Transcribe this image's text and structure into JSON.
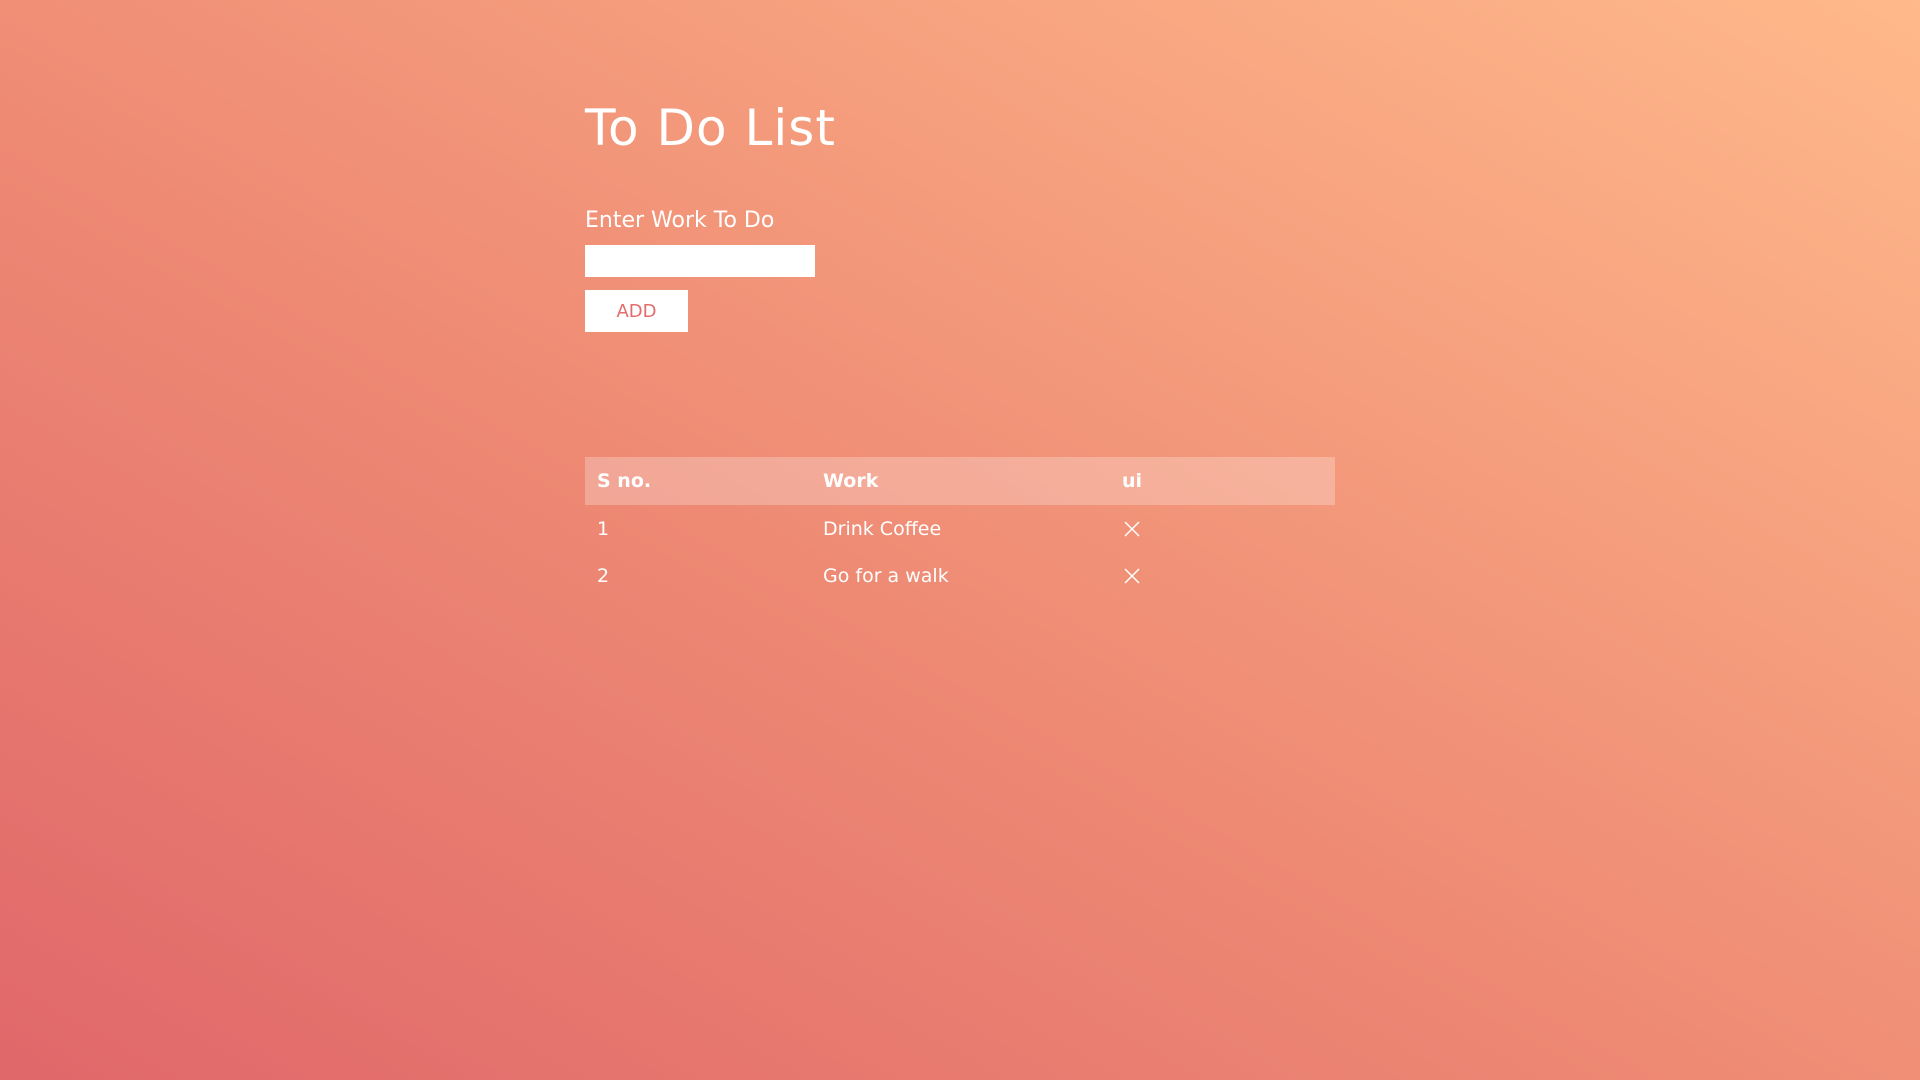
{
  "app": {
    "title": "To Do List"
  },
  "form": {
    "label": "Enter Work To Do",
    "input_value": "",
    "input_placeholder": "",
    "add_label": "ADD"
  },
  "table": {
    "headers": [
      "S no.",
      "Work",
      "ui"
    ],
    "rows": [
      {
        "sno": "1",
        "work": "Drink Coffee",
        "action_icon": "close-icon"
      },
      {
        "sno": "2",
        "work": "Go for a walk",
        "action_icon": "close-icon"
      }
    ]
  },
  "colors": {
    "gradient_start": "#e0676a",
    "gradient_end": "#ffb98a",
    "button_text": "#e36c6c",
    "header_bg": "rgba(255,255,255,0.25)"
  }
}
